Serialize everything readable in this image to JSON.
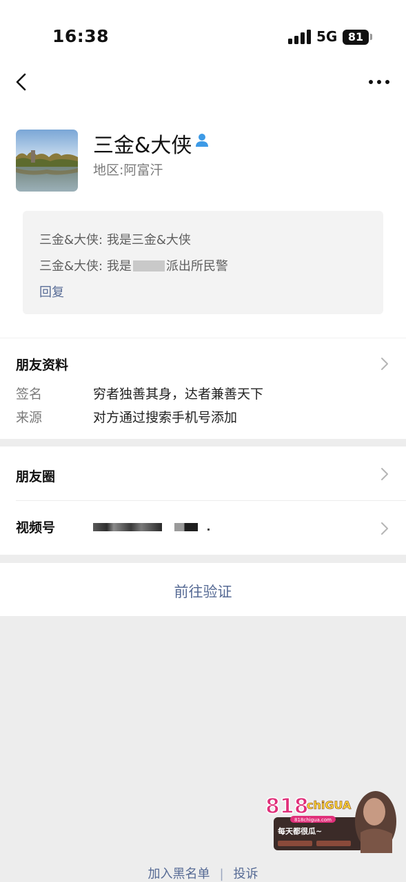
{
  "status_bar": {
    "time": "16:38",
    "network": "5G",
    "battery": "81"
  },
  "nav": {
    "back_icon": "chevron-left-icon",
    "more_icon": "more-dots-icon"
  },
  "profile": {
    "name": "三金&大侠",
    "friend_badge_icon": "person-icon",
    "region_label": "地区:",
    "region_value": "阿富汗",
    "messages": [
      {
        "sender": "三金&大侠:",
        "text": "我是三金&大侠"
      },
      {
        "sender": "三金&大侠:",
        "text_before": "我是",
        "text_after": "派出所民警"
      }
    ],
    "reply_label": "回复"
  },
  "friend_info": {
    "title": "朋友资料",
    "signature_label": "签名",
    "signature_value": "穷者独善其身，达者兼善天下",
    "source_label": "来源",
    "source_value": "对方通过搜索手机号添加"
  },
  "moments": {
    "label": "朋友圈"
  },
  "channels": {
    "label": "视频号"
  },
  "verify": {
    "label": "前往验证"
  },
  "footer": {
    "blacklist_label": "加入黑名单",
    "separator": "|",
    "report_label": "投诉"
  },
  "watermark": {
    "brand": "818",
    "brand_suffix": "chiGUA",
    "domain": "818chigua.com",
    "tagline": "每天都很瓜~"
  },
  "colors": {
    "link": "#576b95",
    "badge": "#3d9ae6",
    "page_background": "#ededed"
  }
}
